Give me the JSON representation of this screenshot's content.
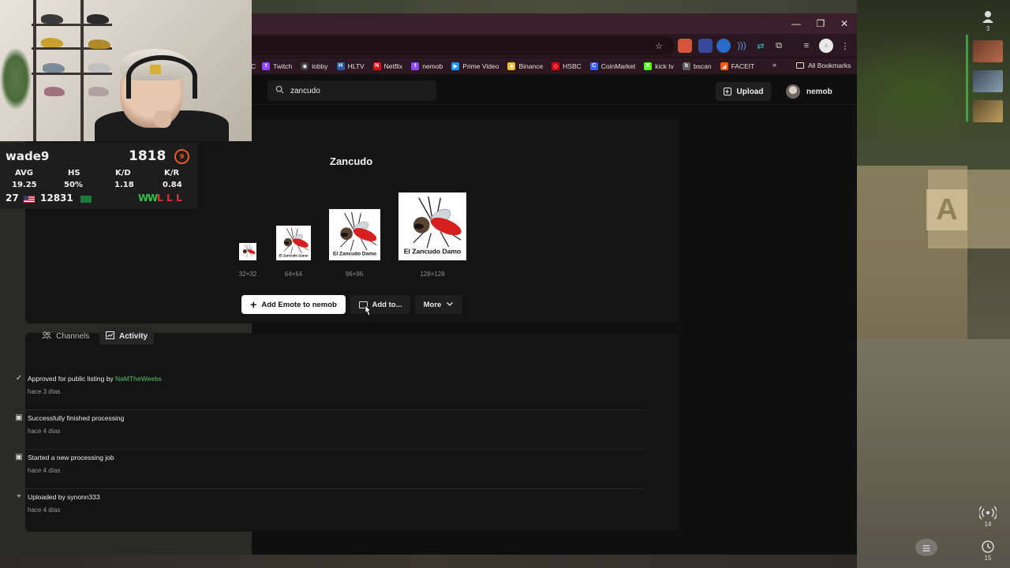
{
  "overlay": {
    "streamer_name": "wade9",
    "elo": "1818",
    "level": "9",
    "headers": [
      "AVG",
      "HS",
      "K/D",
      "K/R"
    ],
    "values": [
      "19.25",
      "50%",
      "1.18",
      "0.84"
    ],
    "rank": "27",
    "points": "12831",
    "recent_results": [
      {
        "r": "W",
        "color": "#35c24a"
      },
      {
        "r": "W",
        "color": "#35c24a"
      },
      {
        "r": "L",
        "color": "#e03030"
      },
      {
        "r": "L",
        "color": "#e03030"
      },
      {
        "r": "L",
        "color": "#e03030"
      }
    ]
  },
  "right_overlay": {
    "viewer_count": "3",
    "ping_value": "14",
    "history_value": "15"
  },
  "browser": {
    "bookmarks": [
      {
        "label": "Twitch",
        "color": "#9146ff",
        "glyph": "t"
      },
      {
        "label": "lobby",
        "color": "#3a3a3a",
        "glyph": "◉"
      },
      {
        "label": "HLTV",
        "color": "#2a5aa0",
        "glyph": "H"
      },
      {
        "label": "Netflix",
        "color": "#e50914",
        "glyph": "N"
      },
      {
        "label": "nemob",
        "color": "#9146ff",
        "glyph": "t"
      },
      {
        "label": "Prime Video",
        "color": "#1a98ff",
        "glyph": "▶"
      },
      {
        "label": "Binance",
        "color": "#f3ba2f",
        "glyph": "◆"
      },
      {
        "label": "HSBC",
        "color": "#db0011",
        "glyph": "◇"
      },
      {
        "label": "CoinMarket",
        "color": "#3861fb",
        "glyph": "C"
      },
      {
        "label": "kick tv",
        "color": "#53fc18",
        "glyph": "K"
      },
      {
        "label": "bscan",
        "color": "#5c5c5c",
        "glyph": "b"
      },
      {
        "label": "FACEIT",
        "color": "#ff5500",
        "glyph": "◢"
      }
    ],
    "all_bookmarks_label": "All Bookmarks",
    "partial_bookmark": "C"
  },
  "header": {
    "search_value": "zancudo",
    "upload_label": "Upload",
    "username": "nemob"
  },
  "emote": {
    "name": "Zancudo",
    "image_caption": "El Zancudo Damo",
    "sizes": [
      "32×32",
      "64×64",
      "96×96",
      "128×128"
    ],
    "add_label": "Add Emote to nemob",
    "add_to_label": "Add to...",
    "more_label": "More"
  },
  "tabs": {
    "channels": "Channels",
    "activity": "Activity"
  },
  "activity": [
    {
      "icon": "check",
      "text": "Approved for public listing by",
      "link": "NaMTheWeebs",
      "time": "hace 3 días"
    },
    {
      "icon": "box",
      "text": "Successfully finished processing",
      "link": "",
      "time": "hace 4 días"
    },
    {
      "icon": "box",
      "text": "Started a new processing job",
      "link": "",
      "time": "hace 4 días"
    },
    {
      "icon": "plus",
      "text": "Uploaded by synonn333",
      "link": "",
      "time": "hace 4 días"
    }
  ]
}
